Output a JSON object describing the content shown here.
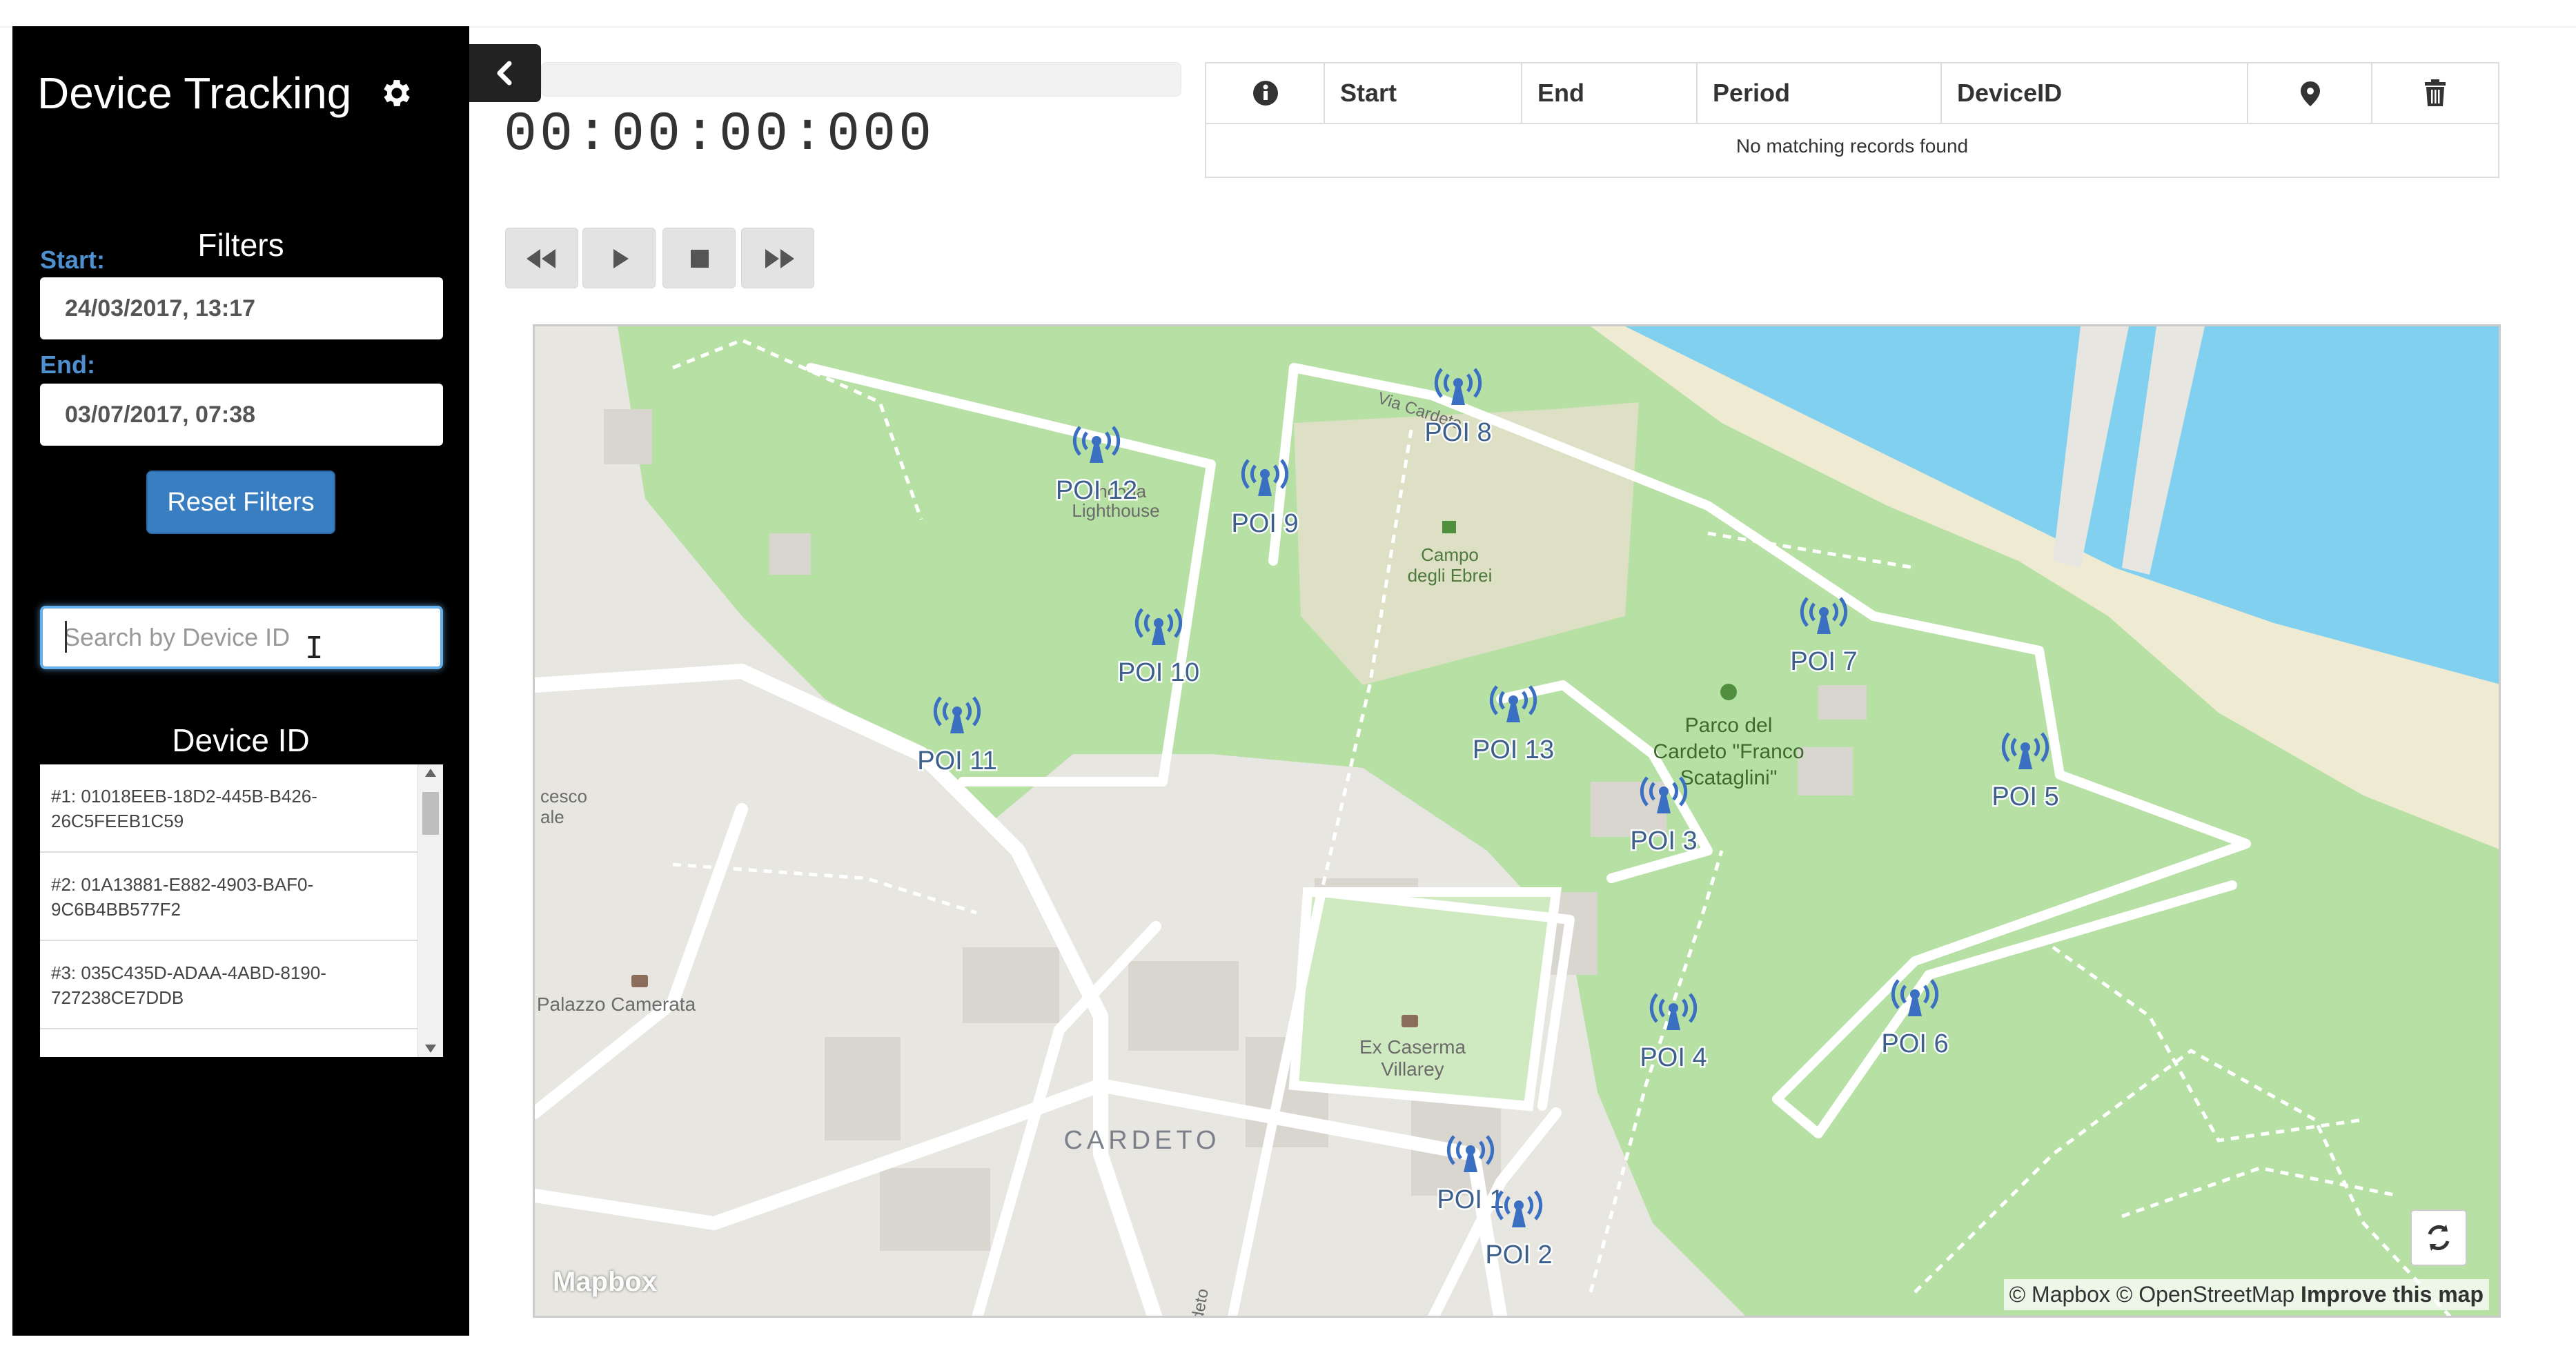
{
  "sidebar": {
    "title": "Device Tracking",
    "filters_title": "Filters",
    "start_label": "Start:",
    "start_value": "24/03/2017, 13:17",
    "end_label": "End:",
    "end_value": "03/07/2017, 07:38",
    "reset_label": "Reset Filters",
    "search_placeholder": "Search by Device ID",
    "device_list_title": "Device ID",
    "devices": [
      {
        "label": "#1: 01018EEB-18D2-445B-B426-26C5FEEB1C59"
      },
      {
        "label": "#2: 01A13881-E882-4903-BAF0-9C6B4BB577F2"
      },
      {
        "label": "#3: 035C435D-ADAA-4ABD-8190-727238CE7DDB"
      }
    ]
  },
  "player": {
    "timer": "00:00:00:000",
    "buttons": [
      "fast-backward",
      "play",
      "stop",
      "fast-forward"
    ]
  },
  "table": {
    "columns": [
      "info-icon",
      "Start",
      "End",
      "Period",
      "DeviceID",
      "map-marker-icon",
      "trash-icon"
    ],
    "headers": {
      "start": "Start",
      "end": "End",
      "period": "Period",
      "device_id": "DeviceID"
    },
    "empty_message": "No matching records found"
  },
  "map": {
    "pois": [
      {
        "label": "POI 1"
      },
      {
        "label": "POI 2"
      },
      {
        "label": "POI 3"
      },
      {
        "label": "POI 4"
      },
      {
        "label": "POI 5"
      },
      {
        "label": "POI 6"
      },
      {
        "label": "POI 7"
      },
      {
        "label": "POI 8"
      },
      {
        "label": "POI 9"
      },
      {
        "label": "POI 10"
      },
      {
        "label": "POI 11"
      },
      {
        "label": "POI 12"
      },
      {
        "label": "POI 13"
      }
    ],
    "place_labels": {
      "ancona": "Ancona",
      "lighthouse": "Lighthouse",
      "campo1": "Campo",
      "campo2": "degli Ebrei",
      "parco1": "Parco del",
      "parco2": "Cardeto \"Franco",
      "parco3": "Scataglini\"",
      "caserma1": "Ex Caserma",
      "caserma2": "Villarey",
      "cardeto": "CARDETO",
      "palazzo": "Palazzo Camerata",
      "via": "Via Cardeto",
      "cesco1": "cesco",
      "cesco2": "ale",
      "ardeto": "ardeto"
    },
    "logo": "Mapbox",
    "attribution": "© Mapbox © OpenStreetMap",
    "improve": "Improve this map",
    "colors": {
      "park": "#b7e0a4",
      "land": "#e8e6e1",
      "water": "#82d0f0",
      "poi": "#3b6fc2",
      "sand": "#efead2"
    }
  }
}
